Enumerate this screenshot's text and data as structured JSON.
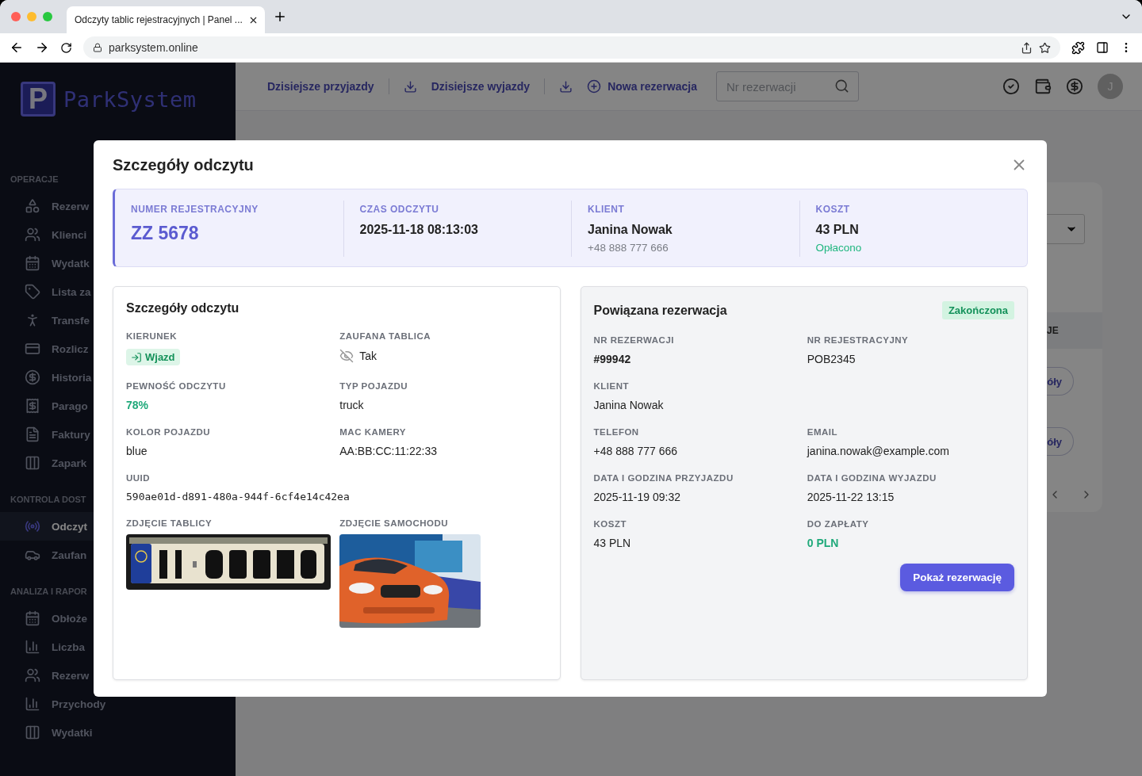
{
  "browser": {
    "tab_title": "Odczyty tablic rejestracyjnych | Panel ...",
    "url": "parksystem.online"
  },
  "sidebar": {
    "logo_mark": "P",
    "logo_text": "ParkSystem",
    "sections": [
      {
        "title": "OPERACJE",
        "items": [
          {
            "label": "Rezerw",
            "selected": false
          },
          {
            "label": "Klienci",
            "selected": false
          },
          {
            "label": "Wydatk",
            "selected": false
          },
          {
            "label": "Lista za",
            "selected": false
          },
          {
            "label": "Transfe",
            "selected": false
          },
          {
            "label": "Rozlicz",
            "selected": false
          },
          {
            "label": "Historia",
            "selected": false
          },
          {
            "label": "Parago",
            "selected": false
          },
          {
            "label": "Faktury",
            "selected": false
          },
          {
            "label": "Zapark",
            "selected": false
          }
        ]
      },
      {
        "title": "KONTROLA DOST",
        "items": [
          {
            "label": "Odczyt",
            "selected": true
          },
          {
            "label": "Zaufan",
            "selected": false
          }
        ]
      },
      {
        "title": "ANALIZA I RAPOR",
        "items": [
          {
            "label": "Obłoże",
            "selected": false
          },
          {
            "label": "Liczba",
            "selected": false
          },
          {
            "label": "Rezerw",
            "selected": false
          },
          {
            "label": "Przychody",
            "selected": false
          },
          {
            "label": "Wydatki",
            "selected": false
          }
        ]
      }
    ]
  },
  "header": {
    "links": [
      {
        "label": "Dzisiejsze przyjazdy",
        "kind": "download"
      },
      {
        "label": "Dzisiejsze wyjazdy",
        "kind": "download"
      },
      {
        "label": "Nowa rezerwacja",
        "kind": "add"
      }
    ],
    "search": {
      "placeholder": "Nr rezerwacji"
    },
    "avatar": "J"
  },
  "background_card": {
    "column_header": "JE",
    "buttons": [
      "óły",
      "óły"
    ]
  },
  "modal": {
    "title": "Szczegóły odczytu",
    "summary": [
      {
        "label": "NUMER REJESTRACYJNY",
        "value": "ZZ 5678",
        "kind": "plate"
      },
      {
        "label": "CZAS ODCZYTU",
        "value": "2025-11-18 08:13:03",
        "kind": "text"
      },
      {
        "label": "KLIENT",
        "value": "Janina Nowak",
        "sub": "+48 888 777 666",
        "kind": "muted"
      },
      {
        "label": "KOSZT",
        "value": "43 PLN",
        "sub": "Opłacono",
        "kind": "paid"
      }
    ],
    "details": {
      "title": "Szczegóły odczytu",
      "fields": [
        {
          "label": "KIERUNEK",
          "value": "Wjazd",
          "kind": "badge"
        },
        {
          "label": "ZAUFANA TABLICA",
          "value": "Tak",
          "kind": "icon"
        },
        {
          "label": "PEWNOŚĆ ODCZYTU",
          "value": "78%",
          "kind": "success"
        },
        {
          "label": "TYP POJAZDU",
          "value": "truck",
          "kind": "text"
        },
        {
          "label": "KOLOR POJAZDU",
          "value": "blue",
          "kind": "text"
        },
        {
          "label": "MAC KAMERY",
          "value": "AA:BB:CC:11:22:33",
          "kind": "text"
        },
        {
          "label": "UUID",
          "value": "590ae01d-d891-480a-944f-6cf4e14c42ea",
          "kind": "mono"
        }
      ],
      "photos": [
        {
          "label": "ZDJĘCIE TABLICY",
          "kind": "plate"
        },
        {
          "label": "ZDJĘCIE SAMOCHODU",
          "kind": "car"
        }
      ]
    },
    "reservation": {
      "title": "Powiązana rezerwacja",
      "status": "Zakończona",
      "fields": [
        {
          "label": "NR REZERWACJI",
          "value": "#99942",
          "kind": "strong",
          "wide": false
        },
        {
          "label": "NR REJESTRACYJNY",
          "value": "POB2345",
          "kind": "text",
          "wide": false
        },
        {
          "label": "KLIENT",
          "value": "Janina Nowak",
          "kind": "text",
          "wide": true
        },
        {
          "label": "TELEFON",
          "value": "+48 888 777 666",
          "kind": "text",
          "wide": false
        },
        {
          "label": "EMAIL",
          "value": "janina.nowak@example.com",
          "kind": "text",
          "wide": false
        },
        {
          "label": "DATA I GODZINA PRZYJAZDU",
          "value": "2025-11-19 09:32",
          "kind": "text",
          "wide": false
        },
        {
          "label": "DATA I GODZINA WYJAZDU",
          "value": "2025-11-22 13:15",
          "kind": "text",
          "wide": false
        },
        {
          "label": "KOSZT",
          "value": "43 PLN",
          "kind": "text",
          "wide": false
        },
        {
          "label": "DO ZAPŁATY",
          "value": "0 PLN",
          "kind": "success",
          "wide": false
        }
      ],
      "button": "Pokaż rezerwację"
    }
  }
}
